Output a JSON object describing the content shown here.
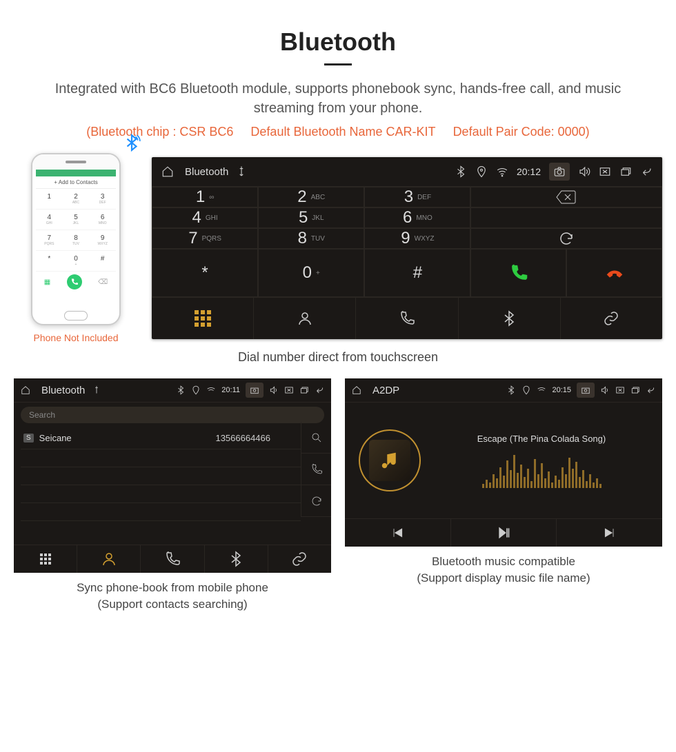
{
  "page": {
    "title": "Bluetooth",
    "description": "Integrated with BC6 Bluetooth module, supports phonebook sync, hands-free call, and music streaming from your phone.",
    "spec_chip": "(Bluetooth chip : CSR BC6",
    "spec_name": "Default Bluetooth Name CAR-KIT",
    "spec_code": "Default Pair Code: 0000)"
  },
  "phone_mock": {
    "add_contacts": "+   Add to Contacts",
    "caption": "Phone Not Included",
    "keys": [
      {
        "n": "1",
        "l": ""
      },
      {
        "n": "2",
        "l": "ABC"
      },
      {
        "n": "3",
        "l": "DEF"
      },
      {
        "n": "4",
        "l": "GHI"
      },
      {
        "n": "5",
        "l": "JKL"
      },
      {
        "n": "6",
        "l": "MNO"
      },
      {
        "n": "7",
        "l": "PQRS"
      },
      {
        "n": "8",
        "l": "TUV"
      },
      {
        "n": "9",
        "l": "WXYZ"
      },
      {
        "n": "*",
        "l": ""
      },
      {
        "n": "0",
        "l": "+"
      },
      {
        "n": "#",
        "l": ""
      }
    ]
  },
  "dialer": {
    "status_title": "Bluetooth",
    "time": "20:12",
    "keys": [
      {
        "num": "1",
        "letters": "∞"
      },
      {
        "num": "2",
        "letters": "ABC"
      },
      {
        "num": "3",
        "letters": "DEF"
      },
      {
        "num": "4",
        "letters": "GHI"
      },
      {
        "num": "5",
        "letters": "JKL"
      },
      {
        "num": "6",
        "letters": "MNO"
      },
      {
        "num": "7",
        "letters": "PQRS"
      },
      {
        "num": "8",
        "letters": "TUV"
      },
      {
        "num": "9",
        "letters": "WXYZ"
      },
      {
        "num": "*",
        "letters": ""
      },
      {
        "num": "0",
        "letters": "+",
        "sup": "+"
      },
      {
        "num": "#",
        "letters": ""
      }
    ],
    "caption": "Dial number direct from touchscreen"
  },
  "contacts": {
    "status_title": "Bluetooth",
    "time": "20:11",
    "search_placeholder": "Search",
    "entry_badge": "S",
    "entry_name": "Seicane",
    "entry_number": "13566664466",
    "caption_line1": "Sync phone-book from mobile phone",
    "caption_line2": "(Support contacts searching)"
  },
  "music": {
    "status_title": "A2DP",
    "time": "20:15",
    "song": "Escape (The Pina Colada Song)",
    "caption_line1": "Bluetooth music compatible",
    "caption_line2": "(Support display music file name)",
    "eq_heights": [
      6,
      12,
      8,
      20,
      14,
      30,
      18,
      40,
      26,
      48,
      22,
      34,
      16,
      28,
      10,
      42,
      20,
      36,
      14,
      24,
      8,
      18,
      12,
      30,
      20,
      44,
      28,
      38,
      16,
      26,
      10,
      20,
      8,
      14,
      6
    ]
  }
}
